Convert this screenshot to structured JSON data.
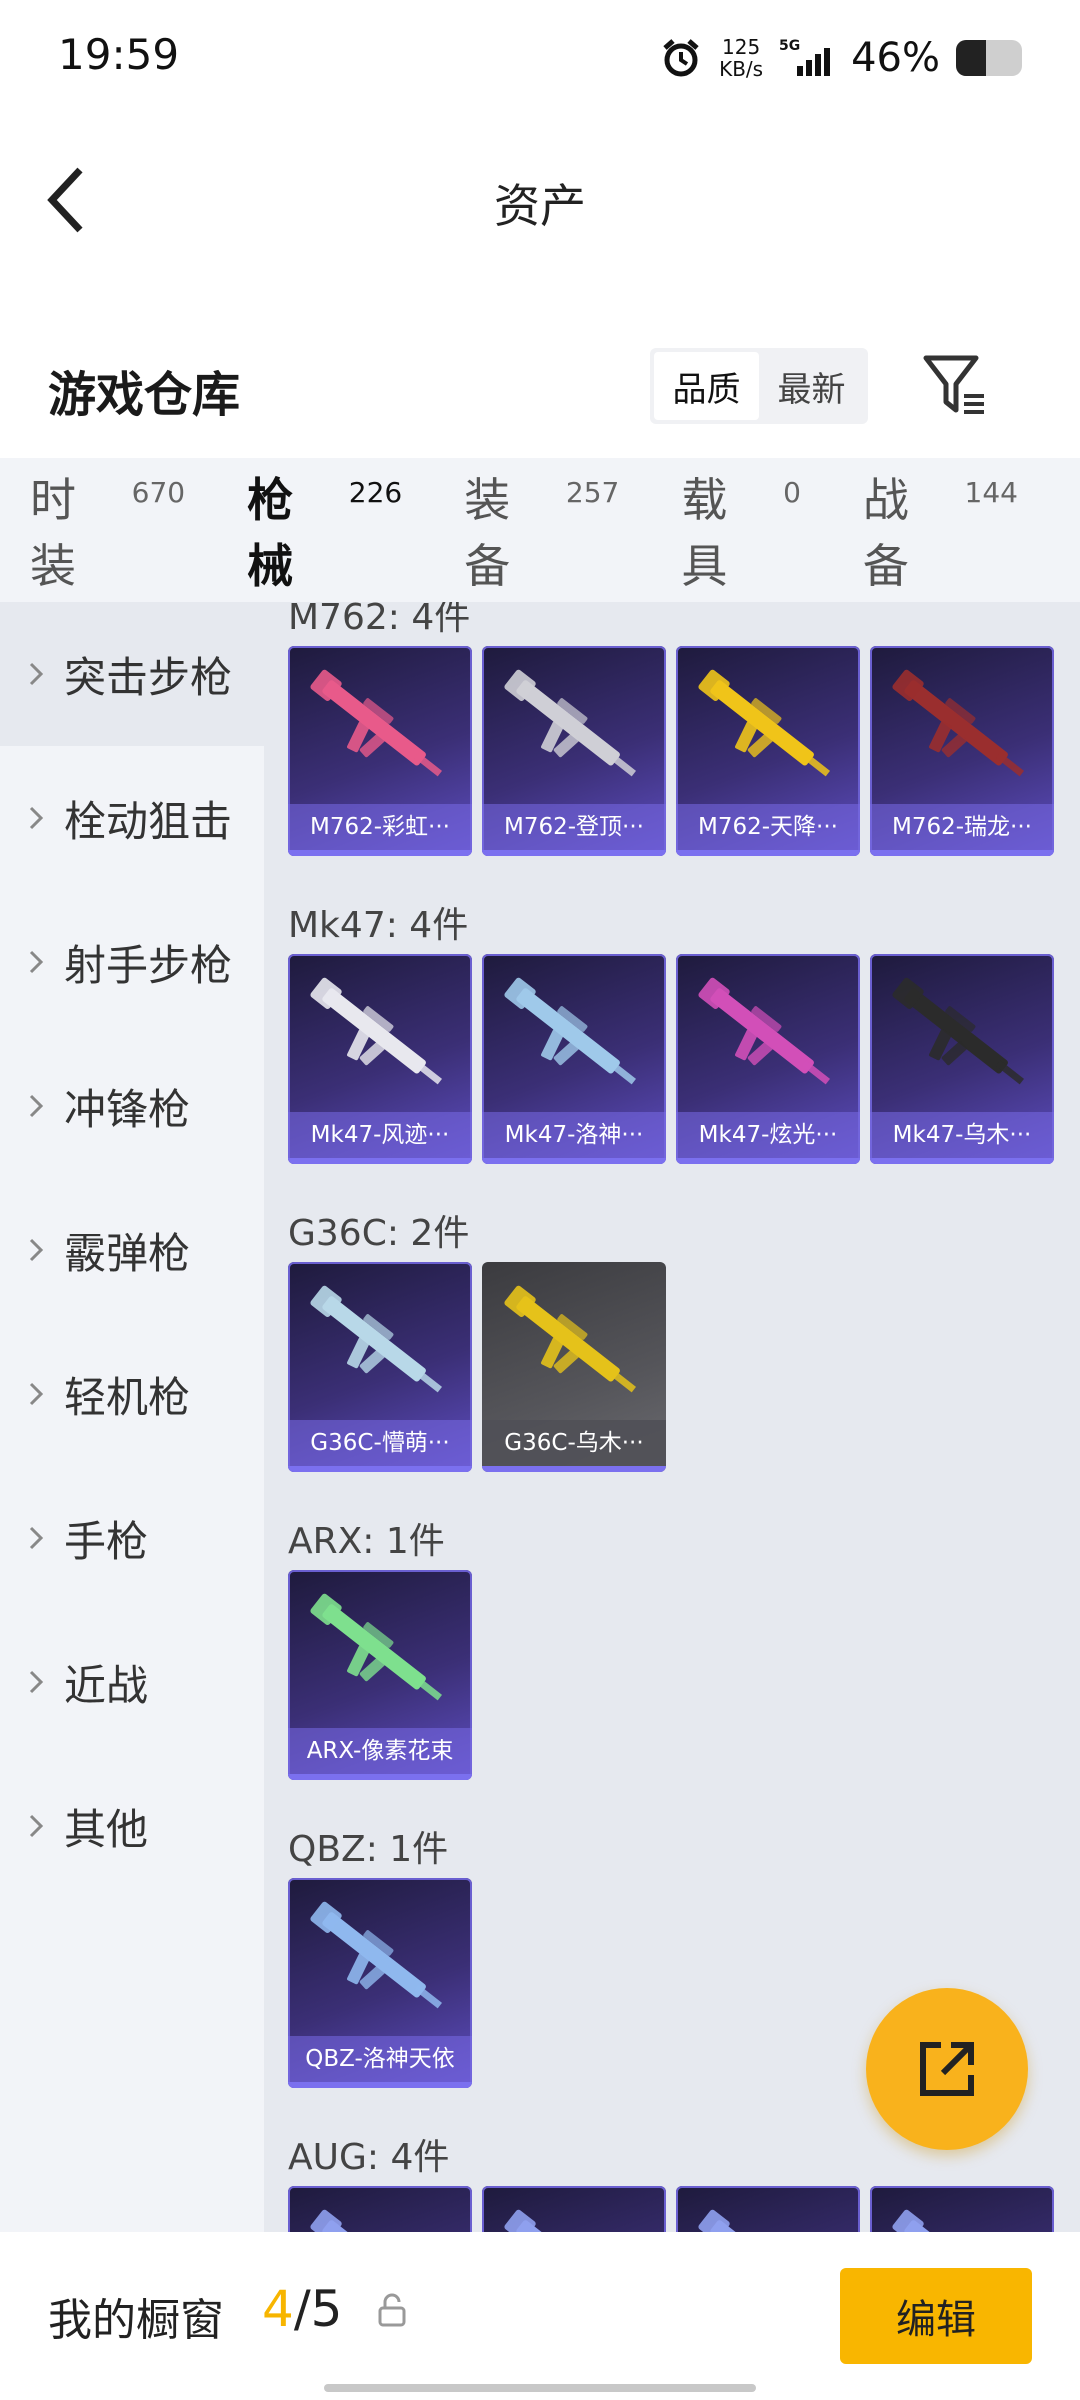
{
  "status_bar": {
    "time": "19:59",
    "net_speed_value": "125",
    "net_speed_unit": "KB/s",
    "network": "5G",
    "battery_percent": "46%",
    "battery_level": 0.46
  },
  "header": {
    "title": "资产"
  },
  "warehouse": {
    "title": "游戏仓库",
    "sort_options": [
      "品质",
      "最新"
    ],
    "sort_active": "品质"
  },
  "tabs": [
    {
      "label": "时装",
      "count": "670"
    },
    {
      "label": "枪械",
      "count": "226"
    },
    {
      "label": "装备",
      "count": "257"
    },
    {
      "label": "载具",
      "count": "0"
    },
    {
      "label": "战备",
      "count": "144"
    }
  ],
  "active_tab": "枪械",
  "sidebar": {
    "items": [
      "突击步枪",
      "栓动狙击",
      "射手步枪",
      "冲锋枪",
      "霰弹枪",
      "轻机枪",
      "手枪",
      "近战",
      "其他"
    ],
    "active": "突击步枪"
  },
  "groups": [
    {
      "title": "M762: 4件",
      "items": [
        {
          "name": "M762-彩虹···",
          "color": "#e85a8a"
        },
        {
          "name": "M762-登顶···",
          "color": "#cfcfd6"
        },
        {
          "name": "M762-天降···",
          "color": "#f0c419"
        },
        {
          "name": "M762-瑞龙···",
          "color": "#9a2e2e"
        }
      ]
    },
    {
      "title": "Mk47: 4件",
      "items": [
        {
          "name": "Mk47-风迹···",
          "color": "#e8e8ee"
        },
        {
          "name": "Mk47-洛神···",
          "color": "#9fc9ea"
        },
        {
          "name": "Mk47-炫光···",
          "color": "#d24fb8"
        },
        {
          "name": "Mk47-乌木···",
          "color": "#2b2b2b"
        }
      ]
    },
    {
      "title": "G36C: 2件",
      "items": [
        {
          "name": "G36C-懵萌···",
          "color": "#b8d8e8"
        },
        {
          "name": "G36C-乌木···",
          "color": "#e5c21a",
          "gray": true
        }
      ]
    },
    {
      "title": "ARX: 1件",
      "items": [
        {
          "name": "ARX-像素花束",
          "color": "#7ee08e"
        }
      ]
    },
    {
      "title": "QBZ: 1件",
      "items": [
        {
          "name": "QBZ-洛神天依",
          "color": "#8fb8ee"
        }
      ]
    },
    {
      "title": "AUG: 4件",
      "items": [
        {
          "name": "",
          "color": "#8fa0ee"
        },
        {
          "name": "",
          "color": "#8fa0ee"
        },
        {
          "name": "",
          "color": "#8fa0ee"
        },
        {
          "name": "",
          "color": "#8fa0ee"
        }
      ]
    }
  ],
  "bottom_bar": {
    "label": "我的橱窗",
    "count_current": "4",
    "count_separator": "/",
    "count_total": "5",
    "edit_label": "编辑"
  },
  "colors": {
    "accent": "#f9b600",
    "card_purple": "#3b2f76"
  }
}
